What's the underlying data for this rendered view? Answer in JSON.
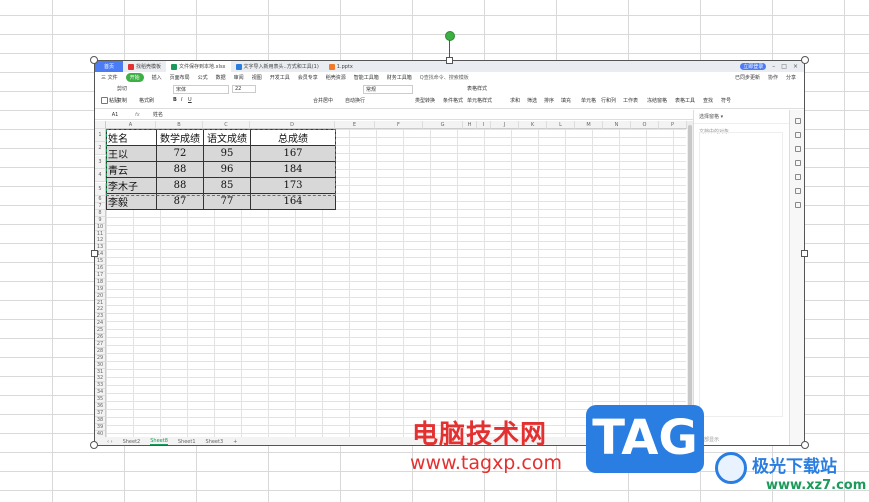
{
  "browser_tabs": [
    {
      "label": "首页",
      "color": "#4c7cf3"
    },
    {
      "label": "找稻壳模板",
      "color": "#e33030"
    },
    {
      "label": "文件保存到本地.xlsx",
      "color": "#1a9b5a"
    },
    {
      "label": "文字导入新用表头..方式和工具(1)",
      "color": "#2a7de1"
    },
    {
      "label": "1.pptx",
      "color": "#f07a2a"
    }
  ],
  "menu": {
    "file": "三 文件",
    "start": "开始",
    "items": [
      "插入",
      "页面布局",
      "公式",
      "数据",
      "审阅",
      "视图",
      "开发工具",
      "会员专享",
      "稻壳资源",
      "智能工具箱",
      "财务工具箱"
    ],
    "search": "Q查找命令、搜索模板",
    "right": [
      "已同步更新",
      "协作",
      "分享"
    ]
  },
  "ribbon": {
    "paste": "粘贴",
    "cut": "剪切",
    "copy": "复制",
    "format_painter": "格式刷",
    "font": "宋体",
    "font_size": "22",
    "merge": "合并居中",
    "wrap": "自动换行",
    "number_format": "常规",
    "type_convert": "类型转换",
    "cond_format": "条件格式",
    "table_style": "表格样式",
    "cell_style": "单元格样式",
    "sum": "求和",
    "filter": "筛选",
    "sort": "排序",
    "fill": "填充",
    "cell": "单元格",
    "row_col": "行和列",
    "worksheet": "工作表",
    "freeze": "冻结窗格",
    "table_tools": "表格工具",
    "find": "查找",
    "symbol": "符号"
  },
  "formula_bar": {
    "cell_ref": "A1",
    "fx": "fx",
    "value": "姓名"
  },
  "columns": [
    "A",
    "B",
    "C",
    "D",
    "E",
    "F",
    "G",
    "H",
    "I",
    "J",
    "K",
    "L",
    "M",
    "N",
    "O",
    "P"
  ],
  "table": {
    "headers": [
      "姓名",
      "数学成绩",
      "语文成绩",
      "总成绩"
    ],
    "rows": [
      [
        "王以",
        "72",
        "95",
        "167"
      ],
      [
        "青云",
        "88",
        "96",
        "184"
      ],
      [
        "李木子",
        "88",
        "85",
        "173"
      ],
      [
        "李毅",
        "87",
        "77",
        "164"
      ]
    ]
  },
  "sheet_tabs": [
    "Sheet2",
    "Sheet8",
    "Sheet1",
    "Sheet3"
  ],
  "active_sheet": "Sheet8",
  "pane": {
    "title": "选择窗格 ▾",
    "subtitle": "文档中的对象",
    "bottom": "全部显示"
  },
  "watermark": {
    "cn": "电脑技术网",
    "url": "www.tagxp.com",
    "tag": "TAG",
    "brand": "极光下载站",
    "brand_url": "www.xz7.com"
  },
  "login_button": "立即登录"
}
